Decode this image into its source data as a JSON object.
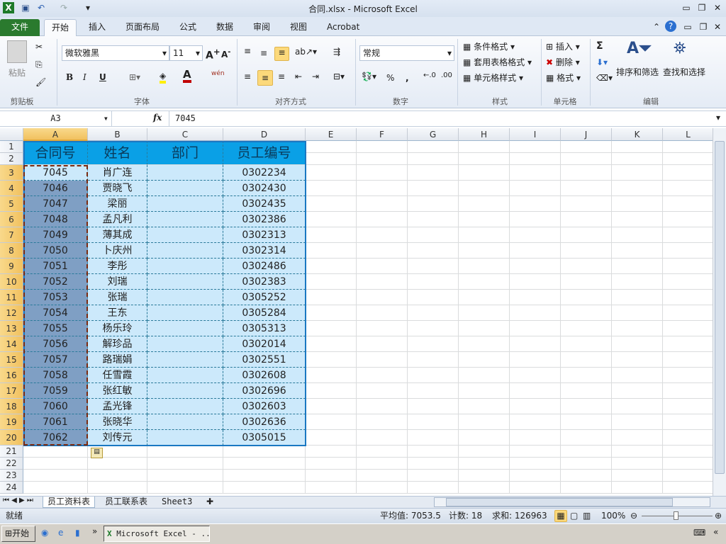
{
  "title": "合同.xlsx  -  Microsoft Excel",
  "tabs": [
    "文件",
    "开始",
    "插入",
    "页面布局",
    "公式",
    "数据",
    "审阅",
    "视图",
    "Acrobat"
  ],
  "ribbon": {
    "clipboard": {
      "paste": "粘贴",
      "label": "剪贴板"
    },
    "font": {
      "name": "微软雅黑",
      "size": "11",
      "label": "字体",
      "bold": "B",
      "italic": "I",
      "underline": "U",
      "phonetic": "wén"
    },
    "align": {
      "label": "对齐方式"
    },
    "number": {
      "format": "常规",
      "percent": "%",
      "comma": ",",
      "label": "数字"
    },
    "styles": {
      "items": [
        "条件格式",
        "套用表格格式",
        "单元格样式"
      ],
      "label": "样式"
    },
    "cells": {
      "items": [
        "插入",
        "删除",
        "格式"
      ],
      "label": "单元格"
    },
    "editing": {
      "sort": "排序和筛选",
      "find": "查找和选择",
      "sum": "Σ",
      "label": "编辑"
    }
  },
  "formula_bar": {
    "name_box": "A3",
    "fx": "fx",
    "value": "7045"
  },
  "columns": [
    "A",
    "B",
    "C",
    "D",
    "E",
    "F",
    "G",
    "H",
    "I",
    "J",
    "K",
    "L"
  ],
  "table": {
    "headers": [
      "合同号",
      "姓名",
      "部门",
      "员工编号"
    ],
    "rows": [
      [
        "7045",
        "肖广连",
        "",
        "0302234"
      ],
      [
        "7046",
        "贾晓飞",
        "",
        "0302430"
      ],
      [
        "7047",
        "梁丽",
        "",
        "0302435"
      ],
      [
        "7048",
        "孟凡利",
        "",
        "0302386"
      ],
      [
        "7049",
        "薄其成",
        "",
        "0302313"
      ],
      [
        "7050",
        "卜庆州",
        "",
        "0302314"
      ],
      [
        "7051",
        "李彤",
        "",
        "0302486"
      ],
      [
        "7052",
        "刘瑞",
        "",
        "0302383"
      ],
      [
        "7053",
        "张瑞",
        "",
        "0305252"
      ],
      [
        "7054",
        "王东",
        "",
        "0305284"
      ],
      [
        "7055",
        "杨乐玲",
        "",
        "0305313"
      ],
      [
        "7056",
        "解珍品",
        "",
        "0302014"
      ],
      [
        "7057",
        "路瑞娟",
        "",
        "0302551"
      ],
      [
        "7058",
        "任雪霞",
        "",
        "0302608"
      ],
      [
        "7059",
        "张红敏",
        "",
        "0302696"
      ],
      [
        "7060",
        "孟光锋",
        "",
        "0302603"
      ],
      [
        "7061",
        "张晓华",
        "",
        "0302636"
      ],
      [
        "7062",
        "刘传元",
        "",
        "0305015"
      ]
    ]
  },
  "row_numbers": [
    "1",
    "2",
    "3",
    "4",
    "5",
    "6",
    "7",
    "8",
    "9",
    "10",
    "11",
    "12",
    "13",
    "14",
    "15",
    "16",
    "17",
    "18",
    "19",
    "20",
    "21",
    "22",
    "23",
    "24"
  ],
  "sheets": [
    "员工资料表",
    "员工联系表",
    "Sheet3"
  ],
  "status": {
    "ready": "就绪",
    "average": "平均值: 7053.5",
    "count": "计数: 18",
    "sum": "求和: 126963",
    "zoom": "100%"
  },
  "taskbar": {
    "start": "开始",
    "window": "Microsoft Excel - ..."
  },
  "colors": {
    "header_fill": "#0aa0e6",
    "table_fill": "#cce9fb",
    "selection": "#7f9fc4",
    "file_tab": "#2a7a2e"
  }
}
